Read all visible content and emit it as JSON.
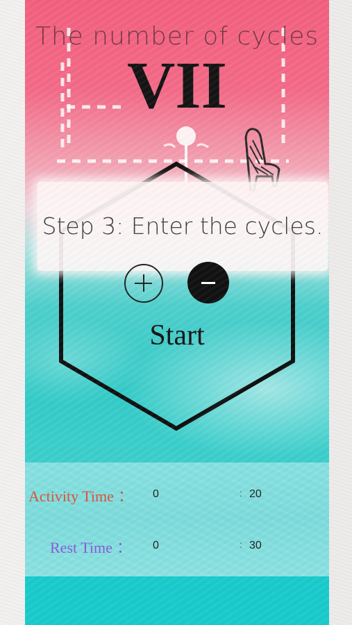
{
  "header": {
    "title": "The number of cycles",
    "cycle_numeral": "VII"
  },
  "instruction": {
    "text": "Step 3: Enter the cycles."
  },
  "controls": {
    "increment_icon": "plus-icon",
    "decrement_icon": "minus-icon",
    "start_label": "Start"
  },
  "timers": {
    "activity": {
      "label": "Activity Time",
      "separator": "：",
      "minutes": "0",
      "colon": ":",
      "seconds": "20",
      "color": "#d9533b"
    },
    "rest": {
      "label": "Rest Time",
      "separator": "：",
      "minutes": "0",
      "colon": ":",
      "seconds": "30",
      "color": "#8b5bd6"
    }
  },
  "decorations": {
    "icons": [
      "dashed-frame",
      "ornament-pin",
      "chair-sketch-icon",
      "hexagon-frame"
    ]
  },
  "colors": {
    "pink_top": "#f3607f",
    "teal": "#33cbc8",
    "panel": "#7adbdb",
    "bottom_band": "#19cbcc"
  }
}
